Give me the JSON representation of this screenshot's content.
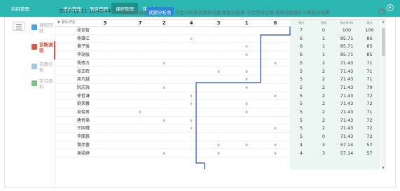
{
  "topnav": {
    "tabs": [
      {
        "label": "科目管理",
        "active": false
      },
      {
        "label": "班本管理",
        "active": false
      },
      {
        "label": "题目管理",
        "active": false
      },
      {
        "label": "课程管理",
        "active": true
      },
      {
        "label": "错题本",
        "active": false
      }
    ]
  },
  "sidebar": {
    "items": [
      {
        "label": "课程回顾",
        "icon": "review-icon",
        "color": "#4aa3df",
        "active": false
      },
      {
        "label": "诊断测验",
        "icon": "diagnosis-icon",
        "color": "#e0533c",
        "active": true
      },
      {
        "label": "答题分析",
        "icon": "analysis-icon",
        "color": "#9fc7e6",
        "active": false
      },
      {
        "label": "学习资料",
        "icon": "materials-icon",
        "color": "#7ec08a",
        "active": false
      }
    ]
  },
  "toolbar": {
    "datetime": "2017-12-11 10:45:44",
    "dropdown": "chevron-down-icon",
    "tabs": [
      {
        "label": "成绩统计报表",
        "active": false
      },
      {
        "label": "试题分析表",
        "active": true
      },
      {
        "label": "学生分析表",
        "active": false
      },
      {
        "label": "答题状况表",
        "active": false
      },
      {
        "label": "题型分配表",
        "active": false
      },
      {
        "label": "学生得分记录",
        "active": false
      },
      {
        "label": "答错分配图",
        "active": false
      },
      {
        "label": "学习表现分布图",
        "active": false
      }
    ]
  },
  "table": {
    "corner": "题号/学生",
    "questions": [
      "5",
      "7",
      "2",
      "4",
      "3",
      "1",
      "6"
    ],
    "right_headers": [
      "答对",
      "答错",
      "答对率(%)",
      "得分"
    ],
    "rows": [
      {
        "name": "张友智",
        "marks": [
          "",
          "",
          "",
          "",
          "",
          "",
          "."
        ],
        "correct": "7",
        "wrong": "0",
        "rate": "100",
        "score": "100"
      },
      {
        "name": "杨肇江",
        "marks": [
          ".",
          ".",
          ".",
          "x",
          ".",
          ".",
          "."
        ],
        "correct": "6",
        "wrong": "1",
        "rate": "85.71",
        "score": "86"
      },
      {
        "name": "黄子骏",
        "marks": [
          ".",
          ".",
          ".",
          ".",
          ".",
          "x",
          "."
        ],
        "correct": "6",
        "wrong": "1",
        "rate": "85.71",
        "score": "85"
      },
      {
        "name": "李澍骏",
        "marks": [
          ".",
          ".",
          ".",
          ".",
          ".",
          "x",
          "."
        ],
        "correct": "6",
        "wrong": "1",
        "rate": "85.71",
        "score": "85"
      },
      {
        "name": "杨倩方",
        "marks": [
          ".",
          ".",
          "x",
          ".",
          ".",
          ".",
          "bx"
        ],
        "correct": "5",
        "wrong": "2",
        "rate": "71.43",
        "score": "71"
      },
      {
        "name": "张正晖",
        "marks": [
          ".",
          ".",
          ".",
          ".",
          "x",
          "bx",
          "."
        ],
        "correct": "5",
        "wrong": "2",
        "rate": "71.43",
        "score": "71"
      },
      {
        "name": "周凡越",
        "marks": [
          ".",
          ".",
          ".",
          ".",
          ".",
          "bx",
          "."
        ],
        "correct": "5",
        "wrong": "2",
        "rate": "71.43",
        "score": "71"
      },
      {
        "name": "阮志强",
        "marks": [
          ".",
          ".",
          "x",
          ".",
          ".",
          "bx",
          "."
        ],
        "correct": "5",
        "wrong": "2",
        "rate": "71.43",
        "score": "70"
      },
      {
        "name": "徐哲谦",
        "marks": [
          ".",
          ".",
          ".",
          "x",
          ".",
          ".",
          "bx"
        ],
        "correct": "5",
        "wrong": "2",
        "rate": "71.43",
        "score": "72"
      },
      {
        "name": "劉英馨",
        "marks": [
          ".",
          ".",
          ".",
          "x",
          ".",
          "bx",
          "."
        ],
        "correct": "5",
        "wrong": "2",
        "rate": "71.43",
        "score": "72"
      },
      {
        "name": "吴俊男",
        "marks": [
          ".",
          "x",
          ".",
          ".",
          ".",
          "bx",
          "."
        ],
        "correct": "5",
        "wrong": "2",
        "rate": "71.43",
        "score": "71"
      },
      {
        "name": "唐侨瑜",
        "marks": [
          ".",
          ".",
          "x",
          "x",
          ".",
          ".",
          "."
        ],
        "correct": "5",
        "wrong": "2",
        "rate": "71.43",
        "score": "72"
      },
      {
        "name": "王国瑾",
        "marks": [
          ".",
          ".",
          ".",
          "x",
          ".",
          ".",
          "bx"
        ],
        "correct": "5",
        "wrong": "2",
        "rate": "71.43",
        "score": "72"
      },
      {
        "name": "李蘭惠",
        "marks": [
          ".",
          ".",
          ".",
          "-",
          ".",
          ".",
          "."
        ],
        "correct": "5",
        "wrong": "0",
        "rate": "71.43",
        "score": "72"
      },
      {
        "name": "黎彦蕾",
        "marks": [
          ".",
          ".",
          ".",
          ".",
          "bx",
          "bx",
          "bx"
        ],
        "correct": "4",
        "wrong": "3",
        "rate": "57.14",
        "score": "57"
      },
      {
        "name": "谢梁婷",
        "marks": [
          ".",
          ".",
          "x",
          ".",
          "bx",
          ".",
          "bx"
        ],
        "correct": "4",
        "wrong": "3",
        "rate": "57.14",
        "score": "57"
      }
    ]
  }
}
